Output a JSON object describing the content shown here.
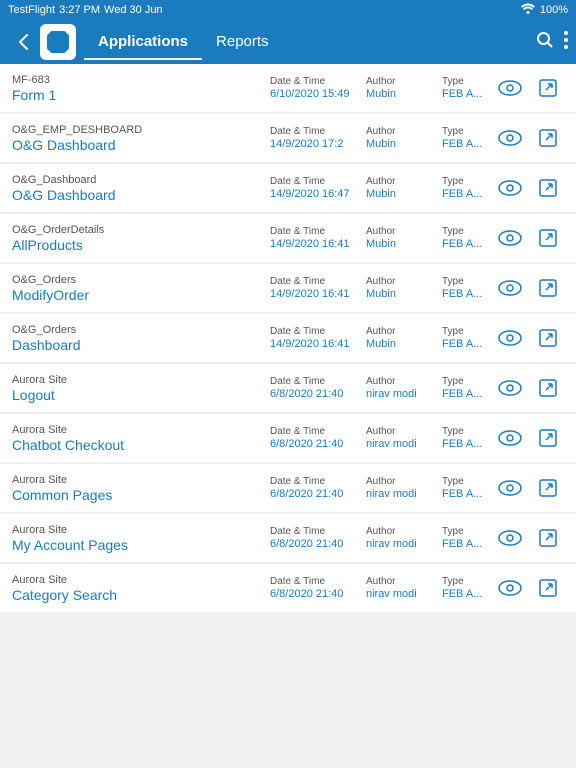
{
  "statusBar": {
    "appName": "TestFlight",
    "time": "3:27 PM",
    "date": "Wed 30 Jun",
    "wifi": "WiFi",
    "battery": "100%"
  },
  "nav": {
    "tabs": [
      {
        "id": "applications",
        "label": "Applications",
        "active": true
      },
      {
        "id": "reports",
        "label": "Reports",
        "active": false
      }
    ],
    "searchLabel": "Search",
    "moreLabel": "More"
  },
  "items": [
    {
      "category": "MF-683",
      "name": "Form 1",
      "dateLabel": "Date & Time",
      "dateValue": "6/10/2020 15:49",
      "authorLabel": "Author",
      "authorValue": "Mubin",
      "typeLabel": "Type",
      "typeValue": "FEB A..."
    },
    {
      "category": "O&G_EMP_DESHBOARD",
      "name": "O&G  Dashboard",
      "dateLabel": "Date & Time",
      "dateValue": "14/9/2020 17:2",
      "authorLabel": "Author",
      "authorValue": "Mubin",
      "typeLabel": "Type",
      "typeValue": "FEB A..."
    },
    {
      "category": "O&G_Dashboard",
      "name": "O&G  Dashboard",
      "dateLabel": "Date & Time",
      "dateValue": "14/9/2020 16:47",
      "authorLabel": "Author",
      "authorValue": "Mubin",
      "typeLabel": "Type",
      "typeValue": "FEB A..."
    },
    {
      "category": "O&G_OrderDetails",
      "name": "AllProducts",
      "dateLabel": "Date & Time",
      "dateValue": "14/9/2020 16:41",
      "authorLabel": "Author",
      "authorValue": "Mubin",
      "typeLabel": "Type",
      "typeValue": "FEB A..."
    },
    {
      "category": "O&G_Orders",
      "name": "ModifyOrder",
      "dateLabel": "Date & Time",
      "dateValue": "14/9/2020 16:41",
      "authorLabel": "Author",
      "authorValue": "Mubin",
      "typeLabel": "Type",
      "typeValue": "FEB A..."
    },
    {
      "category": "O&G_Orders",
      "name": "Dashboard",
      "dateLabel": "Date & Time",
      "dateValue": "14/9/2020 16:41",
      "authorLabel": "Author",
      "authorValue": "Mubin",
      "typeLabel": "Type",
      "typeValue": "FEB A..."
    },
    {
      "category": "Aurora Site",
      "name": "Logout",
      "dateLabel": "Date & Time",
      "dateValue": "6/8/2020 21:40",
      "authorLabel": "Author",
      "authorValue": "nirav modi",
      "typeLabel": "Type",
      "typeValue": "FEB A..."
    },
    {
      "category": "Aurora Site",
      "name": "Chatbot Checkout",
      "dateLabel": "Date & Time",
      "dateValue": "6/8/2020 21:40",
      "authorLabel": "Author",
      "authorValue": "nirav modi",
      "typeLabel": "Type",
      "typeValue": "FEB A..."
    },
    {
      "category": "Aurora Site",
      "name": "Common Pages",
      "dateLabel": "Date & Time",
      "dateValue": "6/8/2020 21:40",
      "authorLabel": "Author",
      "authorValue": "nirav modi",
      "typeLabel": "Type",
      "typeValue": "FEB A..."
    },
    {
      "category": "Aurora Site",
      "name": "My Account Pages",
      "dateLabel": "Date & Time",
      "dateValue": "6/8/2020 21:40",
      "authorLabel": "Author",
      "authorValue": "nirav modi",
      "typeLabel": "Type",
      "typeValue": "FEB A..."
    },
    {
      "category": "Aurora Site",
      "name": "Category Search",
      "dateLabel": "Date & Time",
      "dateValue": "6/8/2020 21:40",
      "authorLabel": "Author",
      "authorValue": "nirav modi",
      "typeLabel": "Type",
      "typeValue": "FEB A..."
    }
  ]
}
